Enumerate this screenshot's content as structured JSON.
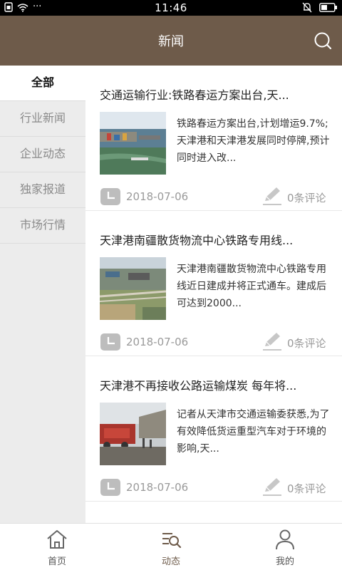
{
  "status_bar": {
    "time": "11:46",
    "dots": "···"
  },
  "header": {
    "title": "新闻",
    "search_icon": "search-icon",
    "bg_color": "#6e5b4a"
  },
  "sidebar": {
    "items": [
      {
        "label": "全部",
        "active": true
      },
      {
        "label": "行业新闻",
        "active": false
      },
      {
        "label": "企业动态",
        "active": false
      },
      {
        "label": "独家报道",
        "active": false
      },
      {
        "label": "市场行情",
        "active": false
      }
    ]
  },
  "articles": [
    {
      "title": "交通运输行业:铁路春运方案出台,天...",
      "summary": "铁路春运方案出台,计划增运9.7%;天津港和天津港发展同时停牌,预计同时进入改...",
      "date": "2018-07-06",
      "comments": "0条评论"
    },
    {
      "title": "天津港南疆散货物流中心铁路专用线...",
      "summary": "天津港南疆散货物流中心铁路专用线近日建成并将正式通车。建成后可达到2000...",
      "date": "2018-07-06",
      "comments": "0条评论"
    },
    {
      "title": "天津港不再接收公路运输煤炭 每年将...",
      "summary": "记者从天津市交通运输委获悉,为了有效降低货运重型汽车对于环境的影响,天...",
      "date": "2018-07-06",
      "comments": "0条评论"
    }
  ],
  "tabbar": {
    "items": [
      {
        "label": "首页",
        "icon": "home-icon",
        "active": false
      },
      {
        "label": "动态",
        "icon": "feed-search-icon",
        "active": true
      },
      {
        "label": "我的",
        "icon": "user-icon",
        "active": false
      }
    ]
  }
}
